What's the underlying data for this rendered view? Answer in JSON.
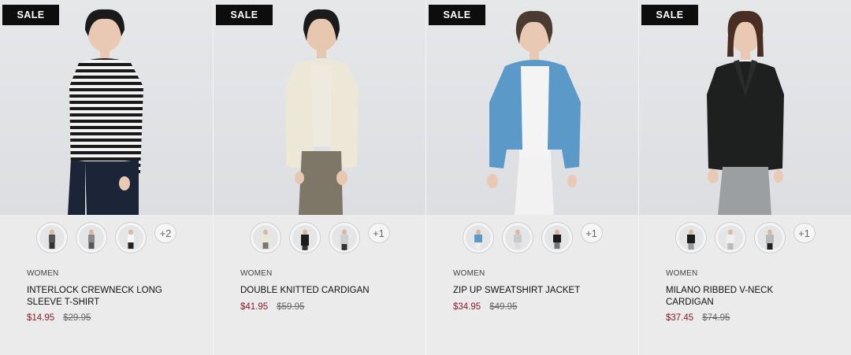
{
  "products": [
    {
      "badge": "SALE",
      "category": "WOMEN",
      "name": "INTERLOCK CREWNECK LONG SLEEVE T-SHIRT",
      "price": "$14.95",
      "original_price": "$29.95",
      "more_colors": "+2"
    },
    {
      "badge": "SALE",
      "category": "WOMEN",
      "name": "DOUBLE KNITTED CARDIGAN",
      "price": "$41.95",
      "original_price": "$59.95",
      "more_colors": "+1"
    },
    {
      "badge": "SALE",
      "category": "WOMEN",
      "name": "ZIP UP SWEATSHIRT JACKET",
      "price": "$34.95",
      "original_price": "$49.95",
      "more_colors": "+1"
    },
    {
      "badge": "SALE",
      "category": "WOMEN",
      "name": "MILANO RIBBED V-NECK CARDIGAN",
      "price": "$37.45",
      "original_price": "$74.95",
      "more_colors": "+1"
    }
  ],
  "colors": {
    "sale_price": "#8b1a2b",
    "badge_bg": "#0d0d0d",
    "page_bg": "#ebebeb"
  }
}
